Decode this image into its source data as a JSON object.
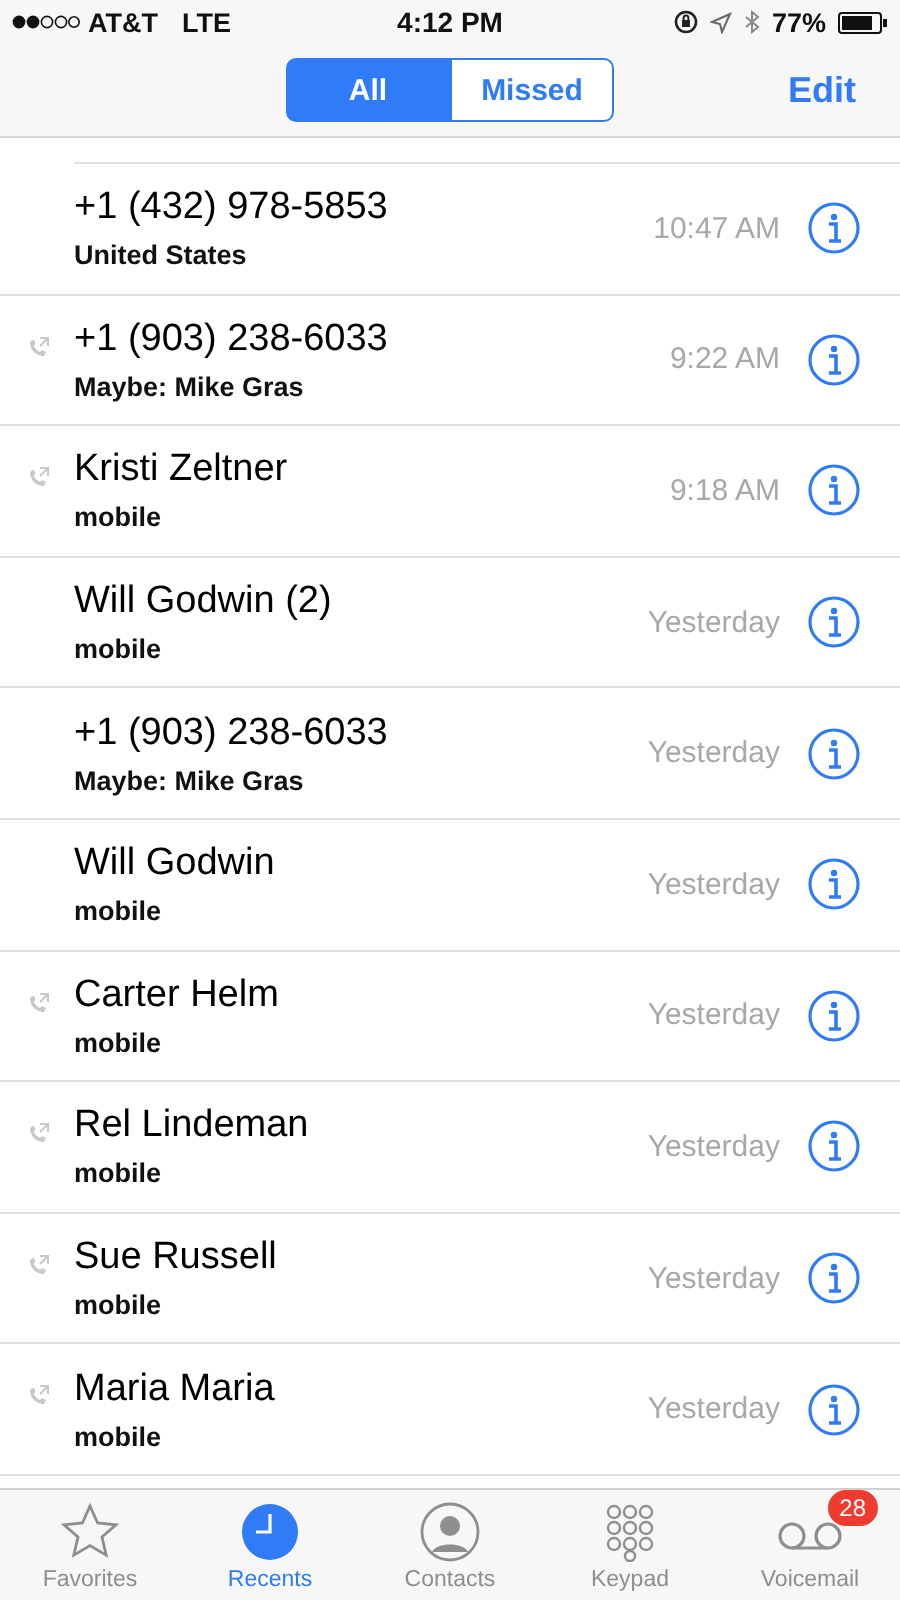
{
  "status_bar": {
    "carrier": "AT&T",
    "network": "LTE",
    "time": "4:12 PM",
    "battery": "77%"
  },
  "segments": [
    {
      "label": "All",
      "selected": true
    },
    {
      "label": "Missed",
      "selected": false
    }
  ],
  "edit_button": "Edit",
  "calls": [
    {
      "name": "+1 (432) 978-5853",
      "detail": "United States",
      "time": "10:47 AM",
      "outgoing": false
    },
    {
      "name": "+1 (903) 238-6033",
      "detail": "Maybe: Mike Gras",
      "time": "9:22 AM",
      "outgoing": true
    },
    {
      "name": "Kristi Zeltner",
      "detail": "mobile",
      "time": "9:18 AM",
      "outgoing": true
    },
    {
      "name": "Will Godwin (2)",
      "detail": "mobile",
      "time": "Yesterday",
      "outgoing": false
    },
    {
      "name": "+1 (903) 238-6033",
      "detail": "Maybe: Mike Gras",
      "time": "Yesterday",
      "outgoing": false
    },
    {
      "name": "Will Godwin",
      "detail": "mobile",
      "time": "Yesterday",
      "outgoing": false
    },
    {
      "name": "Carter Helm",
      "detail": "mobile",
      "time": "Yesterday",
      "outgoing": true
    },
    {
      "name": "Rel Lindeman",
      "detail": "mobile",
      "time": "Yesterday",
      "outgoing": true
    },
    {
      "name": "Sue Russell",
      "detail": "mobile",
      "time": "Yesterday",
      "outgoing": true
    },
    {
      "name": "Maria Maria",
      "detail": "mobile",
      "time": "Yesterday",
      "outgoing": true
    }
  ],
  "tabs": [
    {
      "kind": "star",
      "label": "Favorites",
      "selected": false
    },
    {
      "kind": "clock",
      "label": "Recents",
      "selected": true
    },
    {
      "kind": "person",
      "label": "Contacts",
      "selected": false
    },
    {
      "kind": "keypad",
      "label": "Keypad",
      "selected": false
    },
    {
      "kind": "voicemail",
      "label": "Voicemail",
      "selected": false,
      "badge": "28"
    }
  ]
}
